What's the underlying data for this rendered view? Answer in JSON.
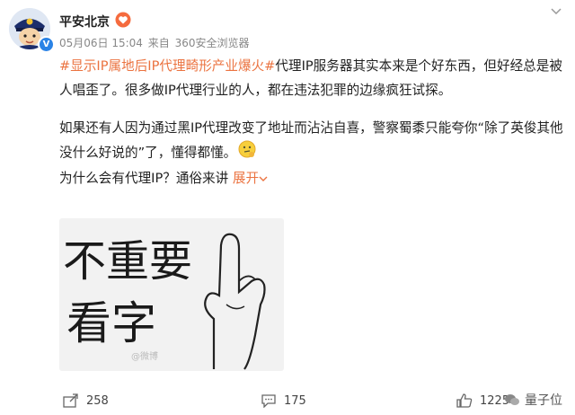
{
  "post": {
    "author": "平安北京",
    "date": "05月06日 15:04",
    "source_prefix": "来自",
    "source": "360安全浏览器",
    "hashtag": "#显示IP属地后IP代理畸形产业爆火#",
    "line1_rest": "代理IP服务器其实本来是个好东西，但好经总是被",
    "line2": "人唱歪了。很多做IP代理行业的人，都在违法犯罪的边缘疯狂试探。",
    "para2_line1": "如果还有人因为通过黑IP代理改变了地址而沾沾自喜，警察蜀黍只能夸你“除了英俊其他",
    "para2_line2": "没什么好说的”了，懂得都懂。",
    "question": "为什么会有代理IP？通俗来讲",
    "expand_label": "展开",
    "image": {
      "line1": "不重要",
      "line2": "看字",
      "watermark": "@微博"
    }
  },
  "actions": {
    "repost_count": "258",
    "comment_count": "175",
    "like_count": "1225"
  },
  "brand": {
    "name": "量子位"
  },
  "colors": {
    "accent": "#eb7340",
    "verified": "#2a83e6"
  },
  "icons": [
    "police-avatar",
    "verified-badge-icon",
    "vip-heart-icon",
    "chevron-down-icon",
    "thinking-emoji-icon",
    "repost-icon",
    "comment-icon",
    "like-icon",
    "wechat-icon"
  ]
}
